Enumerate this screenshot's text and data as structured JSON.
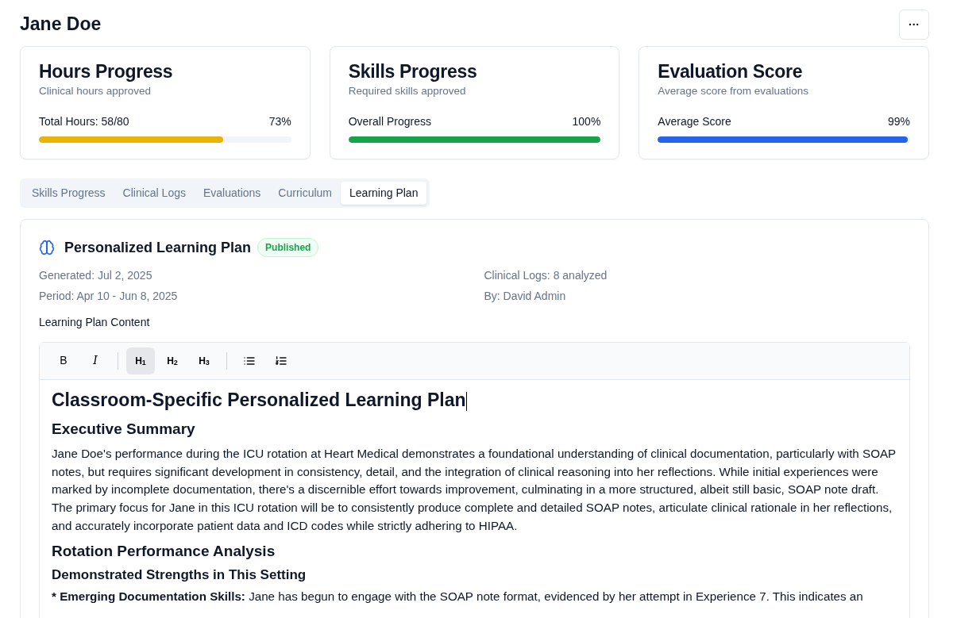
{
  "header": {
    "title": "Jane Doe",
    "menu_button": "···"
  },
  "stats": [
    {
      "title": "Hours Progress",
      "subtitle": "Clinical hours approved",
      "label": "Total Hours: 58/80",
      "reading": "73%",
      "level": 0.73,
      "color": "#eab308"
    },
    {
      "title": "Skills Progress",
      "subtitle": "Required skills approved",
      "label": "Overall Progress",
      "reading": "100%",
      "level": 1.0,
      "color": "#16a34a"
    },
    {
      "title": "Evaluation Score",
      "subtitle": "Average score from evaluations",
      "label": "Average Score",
      "reading": "99%",
      "level": 0.99,
      "color": "#2563eb"
    }
  ],
  "tabs": [
    {
      "label": "Skills Progress",
      "selected": false
    },
    {
      "label": "Clinical Logs",
      "selected": false
    },
    {
      "label": "Evaluations",
      "selected": false
    },
    {
      "label": "Curriculum",
      "selected": false
    },
    {
      "label": "Learning Plan",
      "selected": true
    }
  ],
  "plan": {
    "title": "Personalized Learning Plan",
    "status": "Published",
    "meta": [
      "Generated: Jul 2, 2025",
      "Clinical Logs: 8 analyzed",
      "Period: Apr 10 - Jun 8, 2025",
      "By: David Admin"
    ],
    "content_label": "Learning Plan Content",
    "toolbar": [
      {
        "kind": "bold",
        "label": "B",
        "selected": false
      },
      {
        "kind": "italic",
        "label": "I",
        "selected": false
      },
      {
        "kind": "separator"
      },
      {
        "kind": "heading",
        "label": "H$_{1}$",
        "selected": true
      },
      {
        "kind": "heading",
        "label": "H$_{2}$",
        "selected": false
      },
      {
        "kind": "heading",
        "label": "H$_{3}$",
        "selected": false
      },
      {
        "kind": "separator"
      },
      {
        "kind": "bullets",
        "selected": false
      },
      {
        "kind": "numbers",
        "selected": false
      }
    ],
    "document": [
      {
        "kind": "h1",
        "text": "Classroom-Specific Personalized Learning Plan"
      },
      {
        "kind": "h2",
        "text": "Executive Summary"
      },
      {
        "kind": "p",
        "text": "Jane Doe's performance during the ICU rotation at Heart Medical demonstrates a foundational understanding of clinical documentation, particularly with SOAP notes, but requires significant development in consistency, detail, and the integration of clinical reasoning into her reflections. While initial experiences were marked by incomplete documentation, there's a discernible effort towards improvement, culminating in a more structured, albeit still basic, SOAP note draft. The primary focus for Jane in this ICU rotation will be to consistently produce complete and detailed SOAP notes, articulate clinical rationale in her reflections, and accurately incorporate patient data and ICD codes while strictly adhering to HIPAA."
      },
      {
        "kind": "h2",
        "text": "Rotation Performance Analysis"
      },
      {
        "kind": "h3",
        "text": "Demonstrated Strengths in This Setting"
      },
      {
        "kind": "p",
        "lead": "* Emerging Documentation Skills:",
        "text": "Jane has begun to engage with the SOAP note format, evidenced by her attempt in Experience 7. This indicates an"
      }
    ]
  }
}
